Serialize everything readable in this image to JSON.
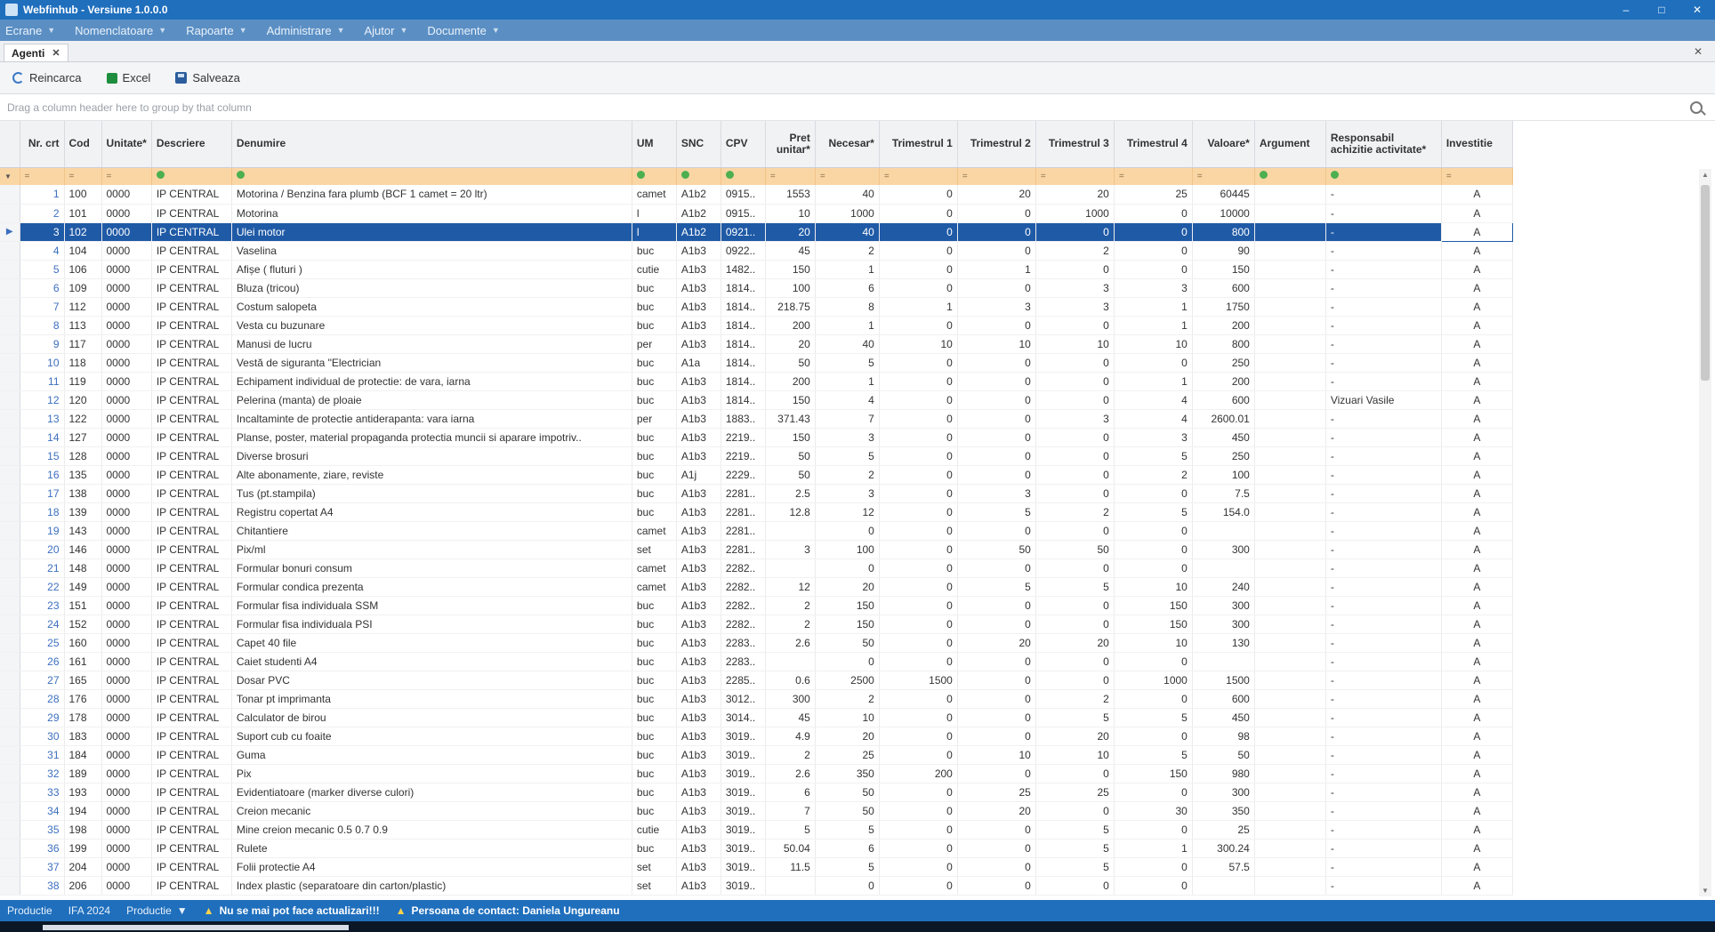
{
  "window": {
    "title": "Webfinhub - Versiune 1.0.0.0",
    "controls": [
      "–",
      "□",
      "✕"
    ]
  },
  "menu": [
    {
      "label": "Ecrane"
    },
    {
      "label": "Nomenclatoare"
    },
    {
      "label": "Rapoarte"
    },
    {
      "label": "Administrare"
    },
    {
      "label": "Ajutor"
    },
    {
      "label": "Documente"
    }
  ],
  "tabs": [
    {
      "label": "Agenti",
      "close": "✕"
    }
  ],
  "tabstrip_close": "✕",
  "toolbar": {
    "refresh": "Reincarca",
    "excel": "Excel",
    "save": "Salveaza"
  },
  "group_panel": {
    "hint": "Drag a column header here to group by that column"
  },
  "columns": [
    {
      "label": "Nr. crt"
    },
    {
      "label": "Cod"
    },
    {
      "label": "Unitate*"
    },
    {
      "label": "Descriere"
    },
    {
      "label": "Denumire"
    },
    {
      "label": "UM"
    },
    {
      "label": "SNC"
    },
    {
      "label": "CPV"
    },
    {
      "label": "Pret unitar*"
    },
    {
      "label": "Necesar*"
    },
    {
      "label": "Trimestrul 1"
    },
    {
      "label": "Trimestrul 2"
    },
    {
      "label": "Trimestrul 3"
    },
    {
      "label": "Trimestrul 4"
    },
    {
      "label": "Valoare*"
    },
    {
      "label": "Argument"
    },
    {
      "label": "Responsabil achizitie activitate*"
    },
    {
      "label": "Investitie"
    }
  ],
  "filter_symbols": {
    "cmp": "=",
    "eq": ""
  },
  "rows": [
    [
      "1",
      "100",
      "0000",
      "IP CENTRAL",
      "Motorina / Benzina fara plumb (BCF 1 camet = 20 ltr)",
      "camet",
      "A1b2",
      "0915..",
      "1553",
      "40",
      "0",
      "20",
      "20",
      "25",
      "60445",
      "",
      "-",
      "A"
    ],
    [
      "2",
      "101",
      "0000",
      "IP CENTRAL",
      "Motorina",
      "l",
      "A1b2",
      "0915..",
      "10",
      "1000",
      "0",
      "0",
      "1000",
      "0",
      "10000",
      "",
      "-",
      "A"
    ],
    [
      "3",
      "102",
      "0000",
      "IP CENTRAL",
      "Ulei motor",
      "l",
      "A1b2",
      "0921..",
      "20",
      "40",
      "0",
      "0",
      "0",
      "0",
      "800",
      "",
      "-",
      "A"
    ],
    [
      "4",
      "104",
      "0000",
      "IP CENTRAL",
      "Vaselina",
      "buc",
      "A1b3",
      "0922..",
      "45",
      "2",
      "0",
      "0",
      "2",
      "0",
      "90",
      "",
      "-",
      "A"
    ],
    [
      "5",
      "106",
      "0000",
      "IP CENTRAL",
      "Afișe ( fluturi )",
      "cutie",
      "A1b3",
      "1482..",
      "150",
      "1",
      "0",
      "1",
      "0",
      "0",
      "150",
      "",
      "-",
      "A"
    ],
    [
      "6",
      "109",
      "0000",
      "IP CENTRAL",
      "Bluza (tricou)",
      "buc",
      "A1b3",
      "1814..",
      "100",
      "6",
      "0",
      "0",
      "3",
      "3",
      "600",
      "",
      "-",
      "A"
    ],
    [
      "7",
      "112",
      "0000",
      "IP CENTRAL",
      "Costum salopeta",
      "buc",
      "A1b3",
      "1814..",
      "218.75",
      "8",
      "1",
      "3",
      "3",
      "1",
      "1750",
      "",
      "-",
      "A"
    ],
    [
      "8",
      "113",
      "0000",
      "IP CENTRAL",
      "Vesta cu buzunare",
      "buc",
      "A1b3",
      "1814..",
      "200",
      "1",
      "0",
      "0",
      "0",
      "1",
      "200",
      "",
      "-",
      "A"
    ],
    [
      "9",
      "117",
      "0000",
      "IP CENTRAL",
      "Manusi de lucru",
      "per",
      "A1b3",
      "1814..",
      "20",
      "40",
      "10",
      "10",
      "10",
      "10",
      "800",
      "",
      "-",
      "A"
    ],
    [
      "10",
      "118",
      "0000",
      "IP CENTRAL",
      "Vestă de siguranta \"Electrician",
      "buc",
      "A1a",
      "1814..",
      "50",
      "5",
      "0",
      "0",
      "0",
      "0",
      "250",
      "",
      "-",
      "A"
    ],
    [
      "11",
      "119",
      "0000",
      "IP CENTRAL",
      "Echipament individual de protectie: de vara, iarna",
      "buc",
      "A1b3",
      "1814..",
      "200",
      "1",
      "0",
      "0",
      "0",
      "1",
      "200",
      "",
      "-",
      "A"
    ],
    [
      "12",
      "120",
      "0000",
      "IP CENTRAL",
      "Pelerina (manta) de ploaie",
      "buc",
      "A1b3",
      "1814..",
      "150",
      "4",
      "0",
      "0",
      "0",
      "4",
      "600",
      "",
      "Vizuari Vasile",
      "A"
    ],
    [
      "13",
      "122",
      "0000",
      "IP CENTRAL",
      "Incaltaminte de protectie antiderapanta: vara iarna",
      "per",
      "A1b3",
      "1883..",
      "371.43",
      "7",
      "0",
      "0",
      "3",
      "4",
      "2600.01",
      "",
      "-",
      "A"
    ],
    [
      "14",
      "127",
      "0000",
      "IP CENTRAL",
      "Planse, poster, material propaganda protectia muncii si aparare impotriv..",
      "buc",
      "A1b3",
      "2219..",
      "150",
      "3",
      "0",
      "0",
      "0",
      "3",
      "450",
      "",
      "-",
      "A"
    ],
    [
      "15",
      "128",
      "0000",
      "IP CENTRAL",
      "Diverse brosuri",
      "buc",
      "A1b3",
      "2219..",
      "50",
      "5",
      "0",
      "0",
      "0",
      "5",
      "250",
      "",
      "-",
      "A"
    ],
    [
      "16",
      "135",
      "0000",
      "IP CENTRAL",
      "Alte abonamente, ziare, reviste",
      "buc",
      "A1j",
      "2229..",
      "50",
      "2",
      "0",
      "0",
      "0",
      "2",
      "100",
      "",
      "-",
      "A"
    ],
    [
      "17",
      "138",
      "0000",
      "IP CENTRAL",
      "Tus (pt.stampila)",
      "buc",
      "A1b3",
      "2281..",
      "2.5",
      "3",
      "0",
      "3",
      "0",
      "0",
      "7.5",
      "",
      "-",
      "A"
    ],
    [
      "18",
      "139",
      "0000",
      "IP CENTRAL",
      "Registru copertat A4",
      "buc",
      "A1b3",
      "2281..",
      "12.8",
      "12",
      "0",
      "5",
      "2",
      "5",
      "154.0",
      "",
      "-",
      "A"
    ],
    [
      "19",
      "143",
      "0000",
      "IP CENTRAL",
      "Chitantiere",
      "camet",
      "A1b3",
      "2281..",
      "",
      "0",
      "0",
      "0",
      "0",
      "0",
      "",
      "",
      "-",
      "A"
    ],
    [
      "20",
      "146",
      "0000",
      "IP CENTRAL",
      "Pix/ml",
      "set",
      "A1b3",
      "2281..",
      "3",
      "100",
      "0",
      "50",
      "50",
      "0",
      "300",
      "",
      "-",
      "A"
    ],
    [
      "21",
      "148",
      "0000",
      "IP CENTRAL",
      "Formular bonuri consum",
      "camet",
      "A1b3",
      "2282..",
      "",
      "0",
      "0",
      "0",
      "0",
      "0",
      "",
      "",
      "-",
      "A"
    ],
    [
      "22",
      "149",
      "0000",
      "IP CENTRAL",
      "Formular condica prezenta",
      "camet",
      "A1b3",
      "2282..",
      "12",
      "20",
      "0",
      "5",
      "5",
      "10",
      "240",
      "",
      "-",
      "A"
    ],
    [
      "23",
      "151",
      "0000",
      "IP CENTRAL",
      "Formular fisa individuala SSM",
      "buc",
      "A1b3",
      "2282..",
      "2",
      "150",
      "0",
      "0",
      "0",
      "150",
      "300",
      "",
      "-",
      "A"
    ],
    [
      "24",
      "152",
      "0000",
      "IP CENTRAL",
      "Formular fisa individuala PSI",
      "buc",
      "A1b3",
      "2282..",
      "2",
      "150",
      "0",
      "0",
      "0",
      "150",
      "300",
      "",
      "-",
      "A"
    ],
    [
      "25",
      "160",
      "0000",
      "IP CENTRAL",
      "Capet 40 file",
      "buc",
      "A1b3",
      "2283..",
      "2.6",
      "50",
      "0",
      "20",
      "20",
      "10",
      "130",
      "",
      "-",
      "A"
    ],
    [
      "26",
      "161",
      "0000",
      "IP CENTRAL",
      "Caiet studenti A4",
      "buc",
      "A1b3",
      "2283..",
      "",
      "0",
      "0",
      "0",
      "0",
      "0",
      "",
      "",
      "-",
      "A"
    ],
    [
      "27",
      "165",
      "0000",
      "IP CENTRAL",
      "Dosar PVC",
      "buc",
      "A1b3",
      "2285..",
      "0.6",
      "2500",
      "1500",
      "0",
      "0",
      "1000",
      "1500",
      "",
      "-",
      "A"
    ],
    [
      "28",
      "176",
      "0000",
      "IP CENTRAL",
      "Tonar pt imprimanta",
      "buc",
      "A1b3",
      "3012..",
      "300",
      "2",
      "0",
      "0",
      "2",
      "0",
      "600",
      "",
      "-",
      "A"
    ],
    [
      "29",
      "178",
      "0000",
      "IP CENTRAL",
      "Calculator de birou",
      "buc",
      "A1b3",
      "3014..",
      "45",
      "10",
      "0",
      "0",
      "5",
      "5",
      "450",
      "",
      "-",
      "A"
    ],
    [
      "30",
      "183",
      "0000",
      "IP CENTRAL",
      "Suport cub cu foaite",
      "buc",
      "A1b3",
      "3019..",
      "4.9",
      "20",
      "0",
      "0",
      "20",
      "0",
      "98",
      "",
      "-",
      "A"
    ],
    [
      "31",
      "184",
      "0000",
      "IP CENTRAL",
      "Guma",
      "buc",
      "A1b3",
      "3019..",
      "2",
      "25",
      "0",
      "10",
      "10",
      "5",
      "50",
      "",
      "-",
      "A"
    ],
    [
      "32",
      "189",
      "0000",
      "IP CENTRAL",
      "Pix",
      "buc",
      "A1b3",
      "3019..",
      "2.6",
      "350",
      "200",
      "0",
      "0",
      "150",
      "980",
      "",
      "-",
      "A"
    ],
    [
      "33",
      "193",
      "0000",
      "IP CENTRAL",
      "Evidentiatoare (marker diverse culori)",
      "buc",
      "A1b3",
      "3019..",
      "6",
      "50",
      "0",
      "25",
      "25",
      "0",
      "300",
      "",
      "-",
      "A"
    ],
    [
      "34",
      "194",
      "0000",
      "IP CENTRAL",
      "Creion mecanic",
      "buc",
      "A1b3",
      "3019..",
      "7",
      "50",
      "0",
      "20",
      "0",
      "30",
      "350",
      "",
      "-",
      "A"
    ],
    [
      "35",
      "198",
      "0000",
      "IP CENTRAL",
      "Mine creion mecanic 0.5 0.7 0.9",
      "cutie",
      "A1b3",
      "3019..",
      "5",
      "5",
      "0",
      "0",
      "5",
      "0",
      "25",
      "",
      "-",
      "A"
    ],
    [
      "36",
      "199",
      "0000",
      "IP CENTRAL",
      "Rulete",
      "buc",
      "A1b3",
      "3019..",
      "50.04",
      "6",
      "0",
      "0",
      "5",
      "1",
      "300.24",
      "",
      "-",
      "A"
    ],
    [
      "37",
      "204",
      "0000",
      "IP CENTRAL",
      "Folii protectie A4",
      "set",
      "A1b3",
      "3019..",
      "11.5",
      "5",
      "0",
      "0",
      "5",
      "0",
      "57.5",
      "",
      "-",
      "A"
    ],
    [
      "38",
      "206",
      "0000",
      "IP CENTRAL",
      "Index plastic (separatoare din carton/plastic)",
      "set",
      "A1b3",
      "3019..",
      "",
      "0",
      "0",
      "0",
      "0",
      "0",
      "",
      "",
      "-",
      "A"
    ]
  ],
  "selected_row_index": 2,
  "status": {
    "left1": "Productie",
    "left2": "IFA 2024",
    "combo": "Productie",
    "warning": "Nu se mai pot face actualizari!!!",
    "contact": "Persoana de contact: Daniela Ungureanu"
  },
  "colors": {
    "titlebar": "#1f6fbd",
    "menubar": "#5b8fc4",
    "filter_row": "#fad6a5",
    "selection": "#1f5aa6"
  }
}
